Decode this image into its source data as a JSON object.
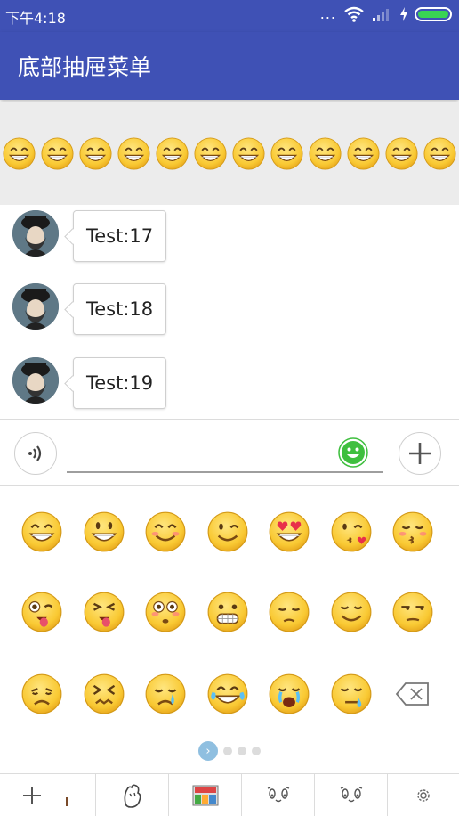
{
  "status_bar": {
    "time": "下午4:18",
    "dots": "..."
  },
  "toolbar": {
    "title": "底部抽屉菜单"
  },
  "emoji_strip": {
    "count": 12,
    "icon": "grinning-emoji-icon"
  },
  "messages": [
    {
      "text": "Test:17"
    },
    {
      "text": "Test:18"
    },
    {
      "text": "Test:19"
    }
  ],
  "input": {
    "value": "",
    "placeholder": ""
  },
  "emoji_grid": {
    "rows": [
      [
        "grin",
        "smiley",
        "blush",
        "wink",
        "heart-eyes",
        "kiss-heart",
        "kiss-closed-eyes"
      ],
      [
        "stuck-out-tongue-wink",
        "stuck-out-tongue-closed-eyes",
        "flushed",
        "grimacing",
        "pensive",
        "relieved",
        "unamused"
      ],
      [
        "disappointed",
        "confounded",
        "crying",
        "joy",
        "sob",
        "sleepy",
        "delete-key"
      ]
    ]
  },
  "pager": {
    "pages": 4,
    "active": 1,
    "active_glyph": "›"
  },
  "tabs": [
    {
      "name": "add",
      "icon": "plus-icon"
    },
    {
      "name": "stickers-1",
      "icon": "hand-sticker-icon"
    },
    {
      "name": "stickers-2",
      "icon": "image-sticker-icon"
    },
    {
      "name": "stickers-3",
      "icon": "face-sticker-icon"
    },
    {
      "name": "stickers-4",
      "icon": "face-sticker-icon"
    },
    {
      "name": "settings",
      "icon": "gear-icon"
    }
  ],
  "colors": {
    "primary": "#3f51b5",
    "emoji": "#f9c933",
    "battery": "#39d353",
    "smile_button": "#3fbf3f"
  }
}
